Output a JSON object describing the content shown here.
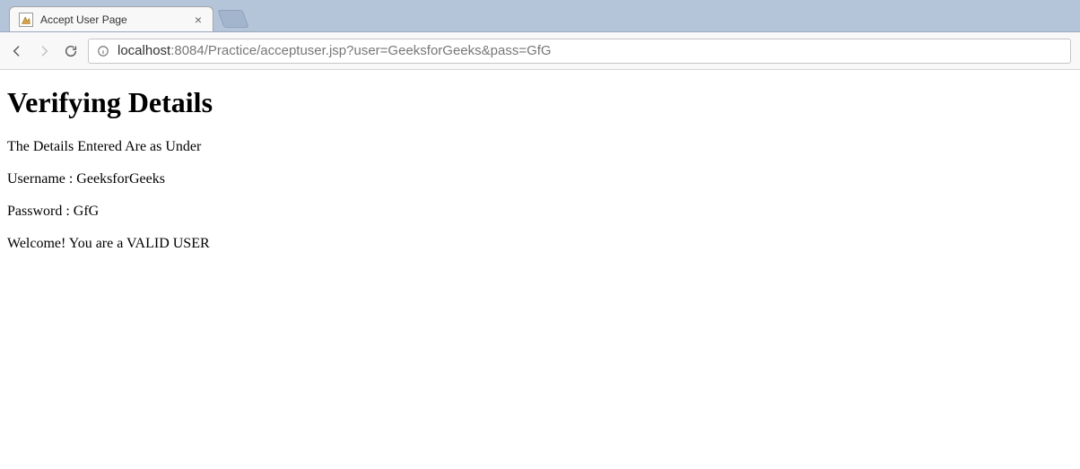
{
  "browser": {
    "tab": {
      "title": "Accept User Page"
    },
    "url": {
      "host": "localhost",
      "rest": ":8084/Practice/acceptuser.jsp?user=GeeksforGeeks&pass=GfG"
    }
  },
  "page": {
    "heading": "Verifying Details",
    "intro_line": "The Details Entered Are as Under",
    "username_line": "Username : GeeksforGeeks",
    "password_line": "Password : GfG",
    "welcome_line": "Welcome! You are a VALID USER"
  }
}
